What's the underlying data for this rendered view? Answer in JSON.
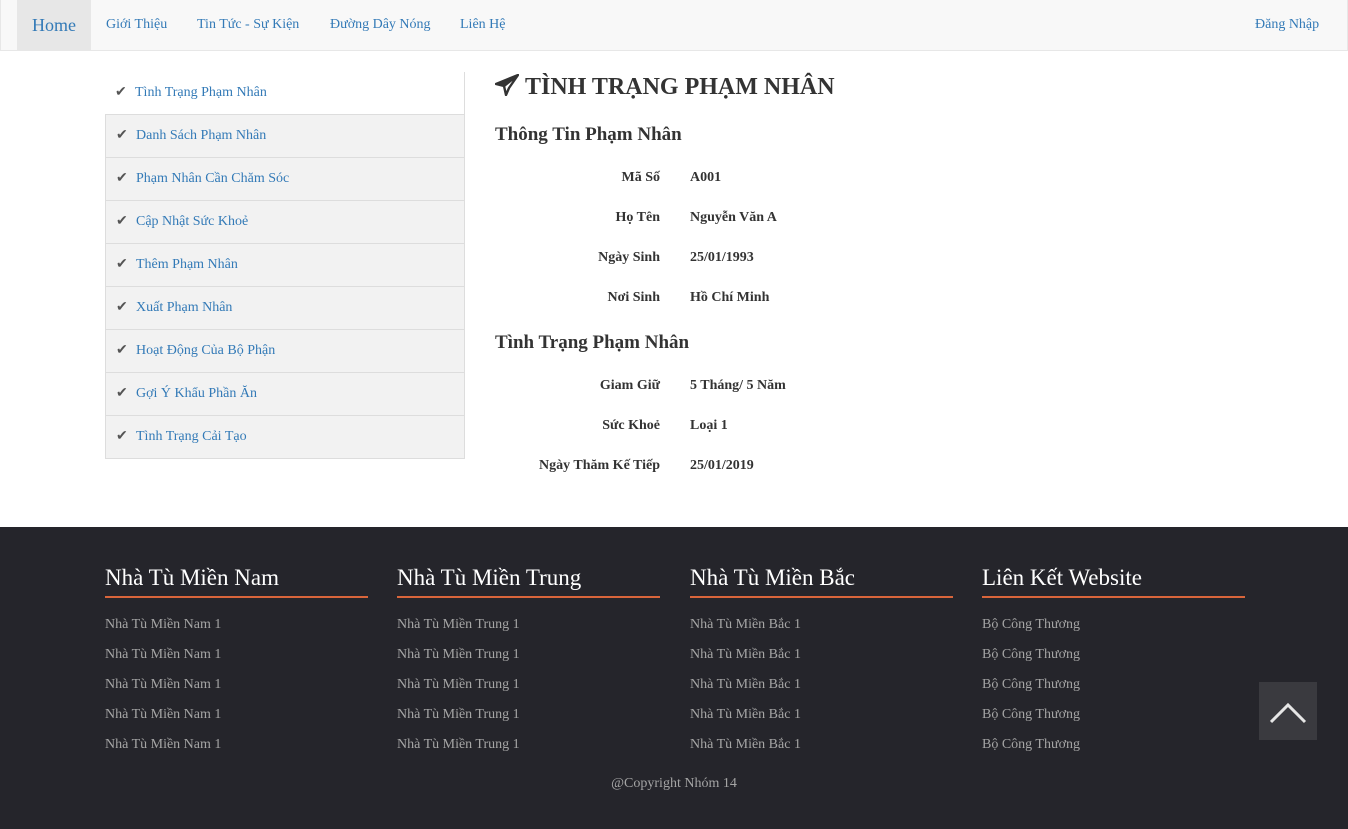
{
  "nav": {
    "home": "Home",
    "items": [
      "Giới Thiệu",
      "Tin Tức - Sự Kiện",
      "Đường Dây Nóng",
      "Liên Hệ"
    ],
    "login": "Đăng Nhập"
  },
  "sidebar": {
    "items": [
      {
        "label": "Tình Trạng Phạm Nhân"
      },
      {
        "label": "Danh Sách Phạm Nhân"
      },
      {
        "label": "Phạm Nhân Cần Chăm Sóc"
      },
      {
        "label": "Cập Nhật Sức Khoẻ"
      },
      {
        "label": "Thêm Phạm Nhân"
      },
      {
        "label": "Xuất Phạm Nhân"
      },
      {
        "label": "Hoạt Động Của Bộ Phận"
      },
      {
        "label": "Gợi Ý Khẩu Phần Ăn"
      },
      {
        "label": "Tình Trạng Cải Tạo"
      }
    ],
    "check_icon": "check-icon"
  },
  "main": {
    "title": "TÌNH TRẠNG PHẠM NHÂN",
    "title_icon": "paper-plane-icon",
    "info_heading": "Thông Tin Phạm Nhân",
    "info": [
      {
        "label": "Mã Số",
        "value": "A001"
      },
      {
        "label": "Họ Tên",
        "value": "Nguyễn Văn A"
      },
      {
        "label": "Ngày Sinh",
        "value": "25/01/1993"
      },
      {
        "label": "Nơi Sinh",
        "value": "Hồ Chí Minh"
      }
    ],
    "status_heading": "Tình Trạng Phạm Nhân",
    "status": [
      {
        "label": "Giam Giữ",
        "value": "5 Tháng/ 5 Năm"
      },
      {
        "label": "Sức Khoẻ",
        "value": "Loại 1"
      },
      {
        "label": "Ngày Thăm Kế Tiếp",
        "value": "25/01/2019"
      }
    ]
  },
  "footer": {
    "columns": [
      {
        "title": "Nhà Tù Miền Nam",
        "links": [
          "Nhà Tù Miền Nam 1",
          "Nhà Tù Miền Nam 1",
          "Nhà Tù Miền Nam 1",
          "Nhà Tù Miền Nam 1",
          "Nhà Tù Miền Nam 1"
        ]
      },
      {
        "title": "Nhà Tù Miền Trung",
        "links": [
          "Nhà Tù Miền Trung 1",
          "Nhà Tù Miền Trung 1",
          "Nhà Tù Miền Trung 1",
          "Nhà Tù Miền Trung 1",
          "Nhà Tù Miền Trung 1"
        ]
      },
      {
        "title": "Nhà Tù Miền Bắc",
        "links": [
          "Nhà Tù Miền Bắc 1",
          "Nhà Tù Miền Bắc 1",
          "Nhà Tù Miền Bắc 1",
          "Nhà Tù Miền Bắc 1",
          "Nhà Tù Miền Bắc 1"
        ]
      },
      {
        "title": "Liên Kết Website",
        "links": [
          "Bộ Công Thương",
          "Bộ Công Thương",
          "Bộ Công Thương",
          "Bộ Công Thương",
          "Bộ Công Thương"
        ]
      }
    ],
    "copyright": "@Copyright Nhóm 14"
  },
  "back_to_top_icon": "chevron-up-icon",
  "colors": {
    "link": "#337ab7",
    "footer_bg": "#25252b",
    "accent": "#d9653b"
  }
}
